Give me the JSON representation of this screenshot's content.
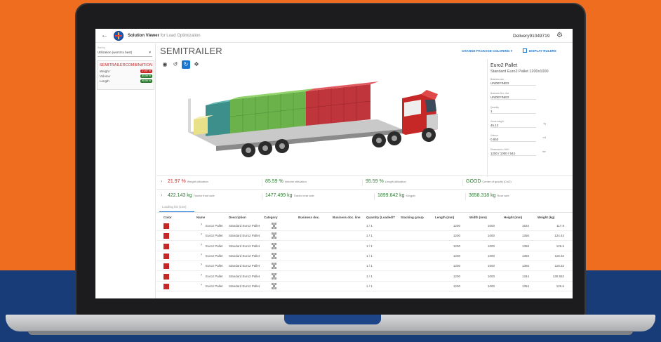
{
  "app": {
    "title": "Solution Viewer",
    "subtitle": "for Load Optimization",
    "delivery": "Delivery91049719"
  },
  "sidebar": {
    "sort_label": "Sort by",
    "sort_value": "Utilization (worst to best)",
    "solution": {
      "title": "SEMITRAILERCOMBINATION",
      "metrics": [
        {
          "label": "Weight",
          "value": "21.97 %",
          "color": "#c62828"
        },
        {
          "label": "Volume",
          "value": "85.59 %",
          "color": "#2e7d32"
        },
        {
          "label": "Length",
          "value": "95.59 %",
          "color": "#2e7d32"
        }
      ]
    }
  },
  "main": {
    "title": "SEMITRAILER",
    "change_coloring": "CHANGE PACKAGE COLORING",
    "display_rulers": "DISPLAY RULERS"
  },
  "details": {
    "title": "Euro2 Pallet",
    "subtitle": "Standard Euro2 Pallet 1200x1000",
    "fields": [
      {
        "label": "Business doc.",
        "value": "UNDEFINED",
        "unit": ""
      },
      {
        "label": "Business Doc. line",
        "value": "UNDEFINED",
        "unit": ""
      },
      {
        "label": "Quantity",
        "value": "1",
        "unit": ""
      },
      {
        "label": "Gross weight",
        "value": "45.12",
        "unit": "kg"
      },
      {
        "label": "Volume",
        "value": "0.653",
        "unit": "m3"
      },
      {
        "label": "Dimensions L/W/H",
        "value": "1200 / 1000 / 544",
        "unit": "mm"
      }
    ]
  },
  "stats": {
    "row1": [
      {
        "value": "21.97 %",
        "label": "Weight utilization",
        "color": "red"
      },
      {
        "value": "85.59 %",
        "label": "Volume utilization",
        "color": "green"
      },
      {
        "value": "95.59 %",
        "label": "Length utilization",
        "color": "green"
      },
      {
        "value": "GOOD",
        "label": "Center of gravity (CoG)",
        "color": "green"
      }
    ],
    "row2": [
      {
        "value": "422.143 kg",
        "label": "Tractor front axle",
        "color": "green"
      },
      {
        "value": "1477.499 kg",
        "label": "Tractor rear axle",
        "color": "green"
      },
      {
        "value": "1899.642 kg",
        "label": "Kingpin",
        "color": "green"
      },
      {
        "value": "3658.318 kg",
        "label": "Rear axle",
        "color": "green"
      }
    ]
  },
  "loading_list": {
    "tab": "Loading list (104)",
    "columns": [
      "Color",
      "Name",
      "Description",
      "Category",
      "Business doc.",
      "Business doc. line",
      "Quantity (Loaded/T",
      "Stacking group",
      "Length (mm)",
      "Width (mm)",
      "Height (mm)",
      "Weight (kg)"
    ],
    "rows": [
      {
        "name": "Euro2 Pallet",
        "description": "Standard Euro2 Pallet",
        "quantity": "1 / 1",
        "length": "1200",
        "width": "1000",
        "height": "1634",
        "weight": "117.9"
      },
      {
        "name": "Euro2 Pallet",
        "description": "Standard Euro2 Pallet",
        "quantity": "1 / 1",
        "length": "1200",
        "width": "1000",
        "height": "1356",
        "weight": "124.44"
      },
      {
        "name": "Euro2 Pallet",
        "description": "Standard Euro2 Pallet",
        "quantity": "1 / 1",
        "length": "1200",
        "width": "1000",
        "height": "1356",
        "weight": "126.6"
      },
      {
        "name": "Euro2 Pallet",
        "description": "Standard Euro2 Pallet",
        "quantity": "1 / 1",
        "length": "1200",
        "width": "1000",
        "height": "1356",
        "weight": "118.32"
      },
      {
        "name": "Euro2 Pallet",
        "description": "Standard Euro2 Pallet",
        "quantity": "1 / 1",
        "length": "1200",
        "width": "1000",
        "height": "1356",
        "weight": "118.32"
      },
      {
        "name": "Euro2 Pallet",
        "description": "Standard Euro2 Pallet",
        "quantity": "1 / 1",
        "length": "1200",
        "width": "1000",
        "height": "1344",
        "weight": "130.552"
      },
      {
        "name": "Euro2 Pallet",
        "description": "Standard Euro2 Pallet",
        "quantity": "1 / 1",
        "length": "1200",
        "width": "1000",
        "height": "1354",
        "weight": "126.6"
      }
    ]
  },
  "colors": {
    "accent": "#1976d2",
    "bad": "#c62828",
    "good": "#2e7d32",
    "background_top": "#ef6d1f",
    "background_bottom": "#173c78"
  }
}
